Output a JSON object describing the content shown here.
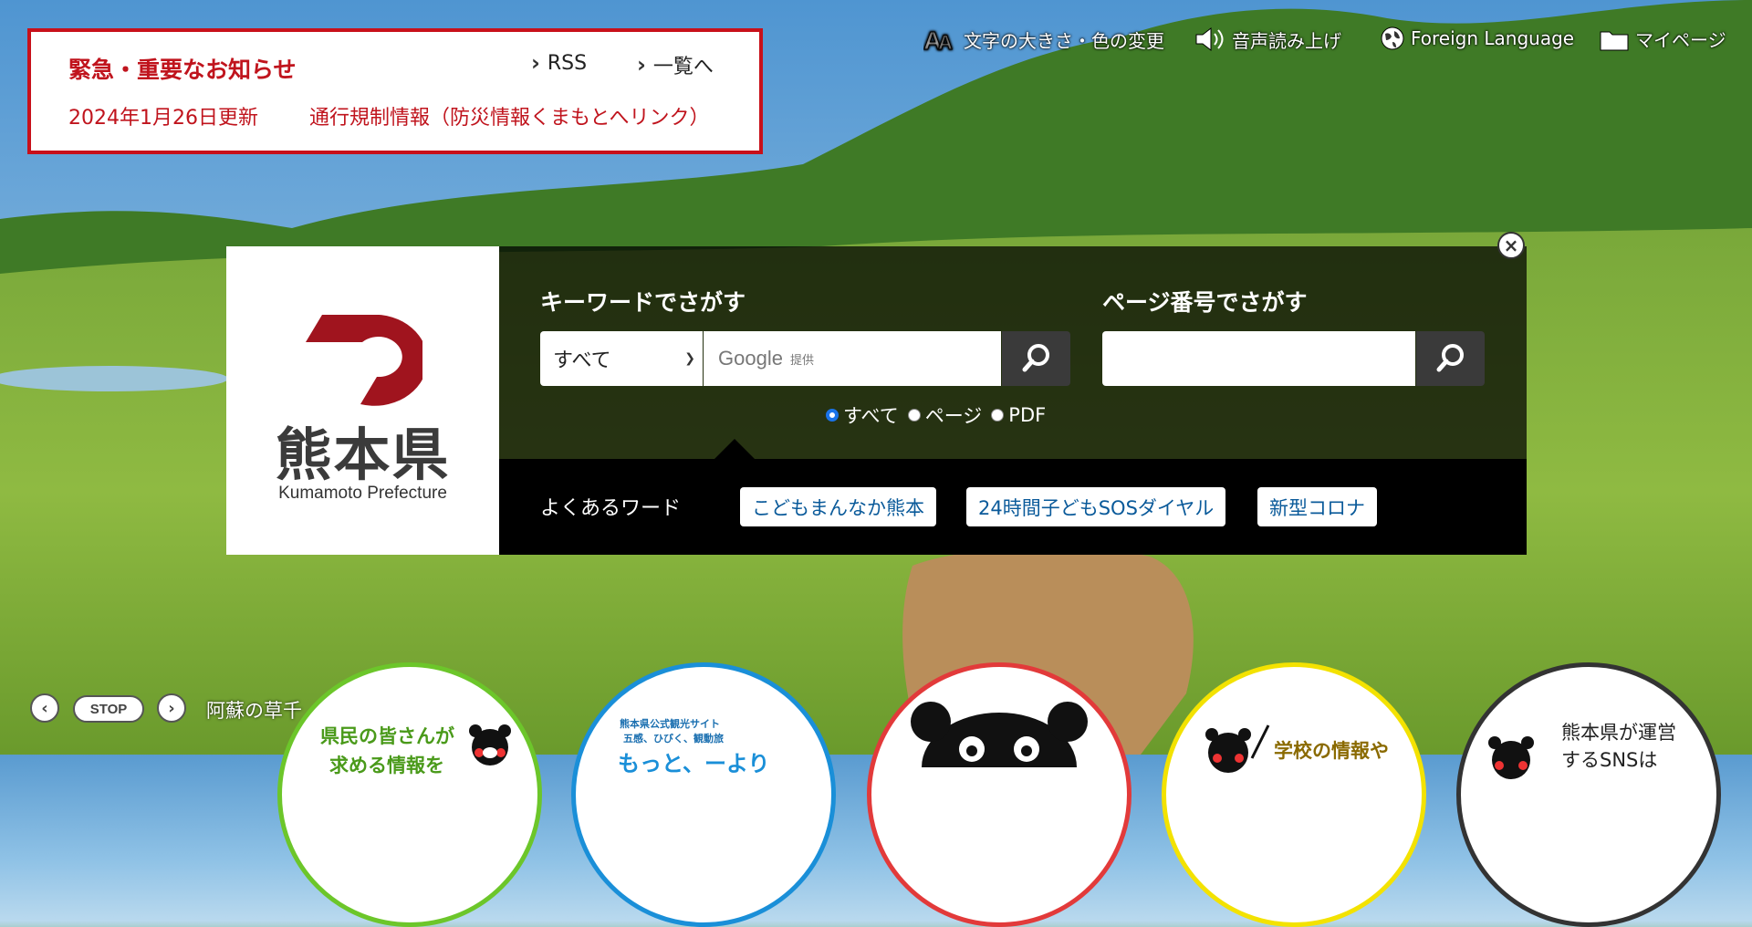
{
  "notice": {
    "title": "緊急・重要なお知らせ",
    "rss": "RSS",
    "list": "一覧へ",
    "date": "2024年1月26日更新",
    "text": "通行規制情報（防災情報くまもとへリンク）"
  },
  "util_nav": {
    "text_size": "文字の大きさ・色の変更",
    "voice": "音声読み上げ",
    "foreign": "Foreign Language",
    "mypage": "マイページ"
  },
  "logo": {
    "jp": "熊本県",
    "en": "Kumamoto Prefecture"
  },
  "search": {
    "keyword_heading": "キーワードでさがす",
    "page_heading": "ページ番号でさがす",
    "scope_selected": "すべて",
    "google_label": "Google",
    "google_sub": "提供",
    "radios": [
      "すべて",
      "ページ",
      "PDF"
    ],
    "radio_selected": "すべて",
    "close": "×"
  },
  "frequent": {
    "label": "よくあるワード",
    "tags": [
      "こどもまんなか熊本",
      "24時間子どもSOSダイヤル",
      "新型コロナ"
    ]
  },
  "slider": {
    "prev": "‹",
    "stop": "STOP",
    "next": "›",
    "caption": "阿蘇の草千"
  },
  "circles": [
    {
      "text": "県民の皆さんが",
      "text2": "求める情報を",
      "color": "#6cc62a"
    },
    {
      "text": "熊本県公式観光サイト",
      "text2": "五感、ひびく、観動旅",
      "text3": "もっと、ーより",
      "color": "#1a8fd8"
    },
    {
      "text": "",
      "color": "#e23a3a"
    },
    {
      "text": "学校の情報や",
      "color": "#f3e200"
    },
    {
      "text": "熊本県が運営",
      "text2": "するSNSは",
      "color": "#333333"
    }
  ],
  "colors": {
    "notice_red": "#c8101a",
    "tag_text": "#0a5a9a",
    "panel": "#000000"
  }
}
